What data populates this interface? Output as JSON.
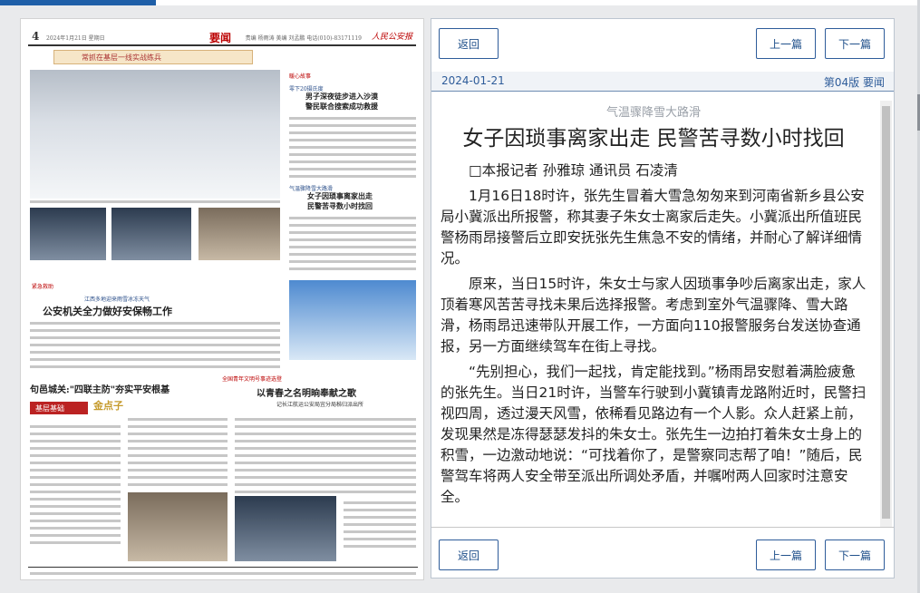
{
  "newspaper": {
    "page_number": "4",
    "date_line": "2024年1月21日 星期日",
    "section": "要闻",
    "info_line": "责编 杨雨涛  美编 刘孟鹏  电话(010)-83171119",
    "logo": "人民公安报",
    "banner": "常抓在基层一线实战练兵",
    "headlines": {
      "h1_tag": "暖心故事",
      "h1_sub": "零下20摄氏度",
      "h1": "男子深夜徒步进入沙漠\n警民联合搜索成功救援",
      "h2_sub": "气温骤降雪大路滑",
      "h2": "女子因琐事离家出走\n民警苦寻数小时找回",
      "h3_sub": "江西多地迎来雨雪冰冻天气",
      "h3": "公安机关全力做好安保畅工作",
      "h4": "句邑城关:\"四联主防\"夯实平安根基",
      "h4_tag": "基层基础",
      "h4_badge": "金点子",
      "h5_tag": "全国青年文明号事迹选登",
      "h5": "以青春之名明晌奉献之歌",
      "h5_sub": "记长江航运公安局宜分局秭归派出所",
      "small_tag": "紧急救助"
    }
  },
  "viewer": {
    "buttons": {
      "back": "返回",
      "prev": "上一篇",
      "next": "下一篇"
    },
    "date": "2024-01-21",
    "edition": "第04版 要闻",
    "pretitle": "气温骤降雪大路滑",
    "title": "女子因琐事离家出走 民警苦寻数小时找回",
    "paragraphs": [
      "□本报记者 孙雅琼 通讯员 石凌清",
      "1月16日18时许，张先生冒着大雪急匆匆来到河南省新乡县公安局小冀派出所报警，称其妻子朱女士离家后走失。小冀派出所值班民警杨雨昂接警后立即安抚张先生焦急不安的情绪，并耐心了解详细情况。",
      "原来，当日15时许，朱女士与家人因琐事争吵后离家出走，家人顶着寒风苦苦寻找未果后选择报警。考虑到室外气温骤降、雪大路滑，杨雨昂迅速带队开展工作，一方面向110报警服务台发送协查通报，另一方面继续驾车在街上寻找。",
      "“先别担心，我们一起找，肯定能找到。”杨雨昂安慰着满脸疲惫的张先生。当日21时许，当警车行驶到小冀镇青龙路附近时，民警扫视四周，透过漫天风雪，依稀看见路边有一个人影。众人赶紧上前，发现果然是冻得瑟瑟发抖的朱女士。张先生一边拍打着朱女士身上的积雪，一边激动地说：“可找着你了，是警察同志帮了咱！”随后，民警驾车将两人安全带至派出所调处矛盾，并嘱咐两人回家时注意安全。"
    ]
  },
  "colors": {
    "accent": "#1f5fa8",
    "link": "#2e5c9a",
    "newspaper_red": "#b00000"
  }
}
